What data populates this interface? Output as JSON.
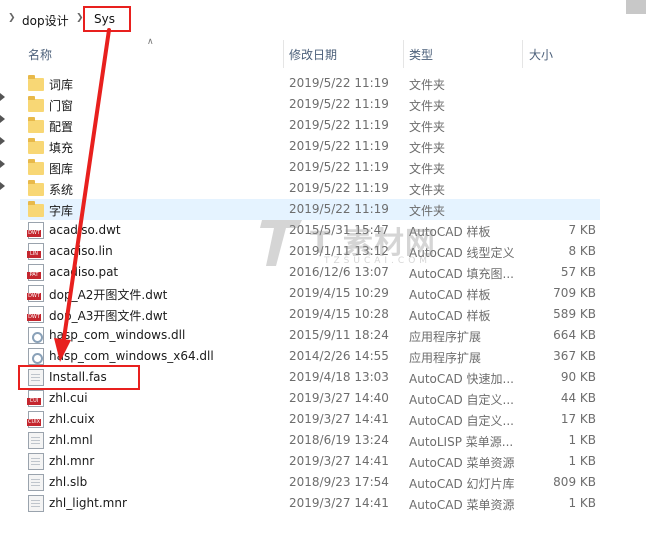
{
  "breadcrumb": {
    "parent": "dop设计",
    "current": "Sys"
  },
  "columns": {
    "name": "名称",
    "date": "修改日期",
    "type": "类型",
    "size": "大小"
  },
  "files": [
    {
      "name": "词库",
      "date": "2019/5/22 11:19",
      "type": "文件夹",
      "size": "",
      "icon": "folder"
    },
    {
      "name": "门窗",
      "date": "2019/5/22 11:19",
      "type": "文件夹",
      "size": "",
      "icon": "folder"
    },
    {
      "name": "配置",
      "date": "2019/5/22 11:19",
      "type": "文件夹",
      "size": "",
      "icon": "folder"
    },
    {
      "name": "填充",
      "date": "2019/5/22 11:19",
      "type": "文件夹",
      "size": "",
      "icon": "folder"
    },
    {
      "name": "图库",
      "date": "2019/5/22 11:19",
      "type": "文件夹",
      "size": "",
      "icon": "folder"
    },
    {
      "name": "系统",
      "date": "2019/5/22 11:19",
      "type": "文件夹",
      "size": "",
      "icon": "folder"
    },
    {
      "name": "字库",
      "date": "2019/5/22 11:19",
      "type": "文件夹",
      "size": "",
      "icon": "folder",
      "selected": true
    },
    {
      "name": "acadiso.dwt",
      "date": "2015/5/31 15:47",
      "type": "AutoCAD 样板",
      "size": "7 KB",
      "icon": "dwt"
    },
    {
      "name": "acadiso.lin",
      "date": "2019/1/11 13:12",
      "type": "AutoCAD 线型定义",
      "size": "8 KB",
      "icon": "lin"
    },
    {
      "name": "acadiso.pat",
      "date": "2016/12/6 13:07",
      "type": "AutoCAD 填充图...",
      "size": "57 KB",
      "icon": "pat"
    },
    {
      "name": "dop_A2开图文件.dwt",
      "date": "2019/4/15 10:29",
      "type": "AutoCAD 样板",
      "size": "709 KB",
      "icon": "dwt"
    },
    {
      "name": "dop_A3开图文件.dwt",
      "date": "2019/4/15 10:28",
      "type": "AutoCAD 样板",
      "size": "589 KB",
      "icon": "dwt"
    },
    {
      "name": "hasp_com_windows.dll",
      "date": "2015/9/11 18:24",
      "type": "应用程序扩展",
      "size": "664 KB",
      "icon": "dll"
    },
    {
      "name": "hasp_com_windows_x64.dll",
      "date": "2014/2/26 14:55",
      "type": "应用程序扩展",
      "size": "367 KB",
      "icon": "dll"
    },
    {
      "name": "Install.fas",
      "date": "2019/4/18 13:03",
      "type": "AutoCAD 快速加...",
      "size": "90 KB",
      "icon": "plain"
    },
    {
      "name": "zhl.cui",
      "date": "2019/3/27 14:40",
      "type": "AutoCAD 自定义...",
      "size": "44 KB",
      "icon": "cui"
    },
    {
      "name": "zhl.cuix",
      "date": "2019/3/27 14:41",
      "type": "AutoCAD 自定义...",
      "size": "17 KB",
      "icon": "cuix"
    },
    {
      "name": "zhl.mnl",
      "date": "2018/6/19 13:24",
      "type": "AutoLISP 菜单源...",
      "size": "1 KB",
      "icon": "plain"
    },
    {
      "name": "zhl.mnr",
      "date": "2019/3/27 14:41",
      "type": "AutoCAD 菜单资源",
      "size": "1 KB",
      "icon": "plain"
    },
    {
      "name": "zhl.slb",
      "date": "2018/9/23 17:54",
      "type": "AutoCAD 幻灯片库",
      "size": "809 KB",
      "icon": "plain"
    },
    {
      "name": "zhl_light.mnr",
      "date": "2019/3/27 14:41",
      "type": "AutoCAD 菜单资源",
      "size": "1 KB",
      "icon": "plain"
    }
  ],
  "watermark": {
    "title": "T 素材网",
    "subtitle": "TZSUCAI.COM"
  },
  "colors": {
    "highlight": "#e8201e",
    "selected_row": "#e5f3ff",
    "folder": "#f8d775",
    "cad_tag": "#c4262e"
  }
}
